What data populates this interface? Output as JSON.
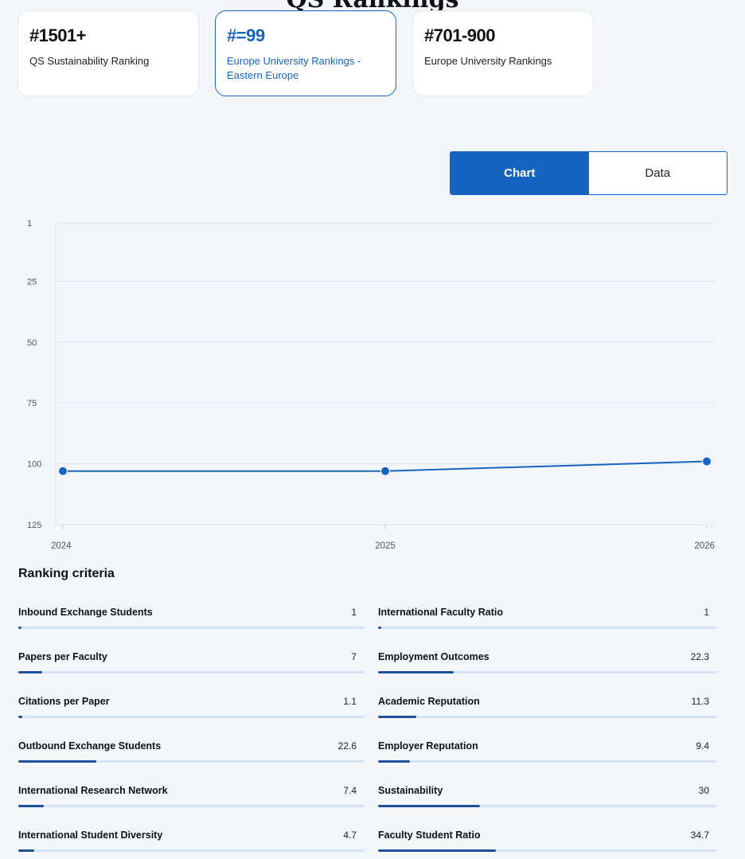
{
  "heading": "QS Rankings",
  "cards": [
    {
      "rank": "#1501+",
      "label": "QS Sustainability Ranking",
      "active": false
    },
    {
      "rank": "#=99",
      "label": "Europe University Rankings - Eastern Europe",
      "active": true
    },
    {
      "rank": "#701-900",
      "label": "Europe University Rankings",
      "active": false
    }
  ],
  "toggle": {
    "chart_label": "Chart",
    "data_label": "Data"
  },
  "chart_data": {
    "type": "line",
    "x": [
      "2024",
      "2025",
      "2026"
    ],
    "series": [
      {
        "values": [
          103,
          103,
          99
        ]
      }
    ],
    "yticks": [
      1,
      25,
      50,
      75,
      100,
      125
    ],
    "ylim": [
      1,
      125
    ],
    "y_inverted": true,
    "grid": true,
    "color": "#1565c0"
  },
  "criteria_title": "Ranking criteria",
  "criteria": [
    {
      "name": "Inbound Exchange Students",
      "value": "1",
      "score": 1
    },
    {
      "name": "International Faculty Ratio",
      "value": "1",
      "score": 1
    },
    {
      "name": "Papers per Faculty",
      "value": "7",
      "score": 7
    },
    {
      "name": "Employment Outcomes",
      "value": "22.3",
      "score": 22.3
    },
    {
      "name": "Citations per Paper",
      "value": "1.1",
      "score": 1.1
    },
    {
      "name": "Academic Reputation",
      "value": "11.3",
      "score": 11.3
    },
    {
      "name": "Outbound Exchange Students",
      "value": "22.6",
      "score": 22.6
    },
    {
      "name": "Employer Reputation",
      "value": "9.4",
      "score": 9.4
    },
    {
      "name": "International Research Network",
      "value": "7.4",
      "score": 7.4
    },
    {
      "name": "Sustainability",
      "value": "30",
      "score": 30
    },
    {
      "name": "International Student Diversity",
      "value": "4.7",
      "score": 4.7
    },
    {
      "name": "Faculty Student Ratio",
      "value": "34.7",
      "score": 34.7
    }
  ]
}
